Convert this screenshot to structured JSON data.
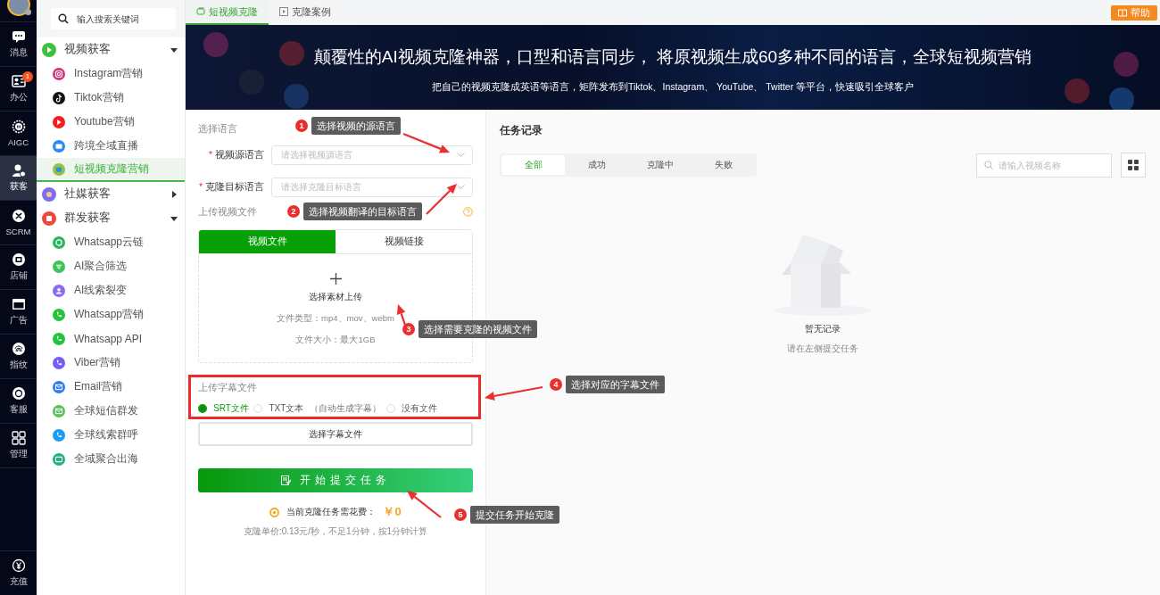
{
  "rail": {
    "items": [
      {
        "label": "消息",
        "selected": false
      },
      {
        "label": "办公",
        "selected": false,
        "badge": "1"
      },
      {
        "label": "AIGC",
        "selected": false
      },
      {
        "label": "获客",
        "selected": true
      },
      {
        "label": "SCRM",
        "selected": false
      },
      {
        "label": "店铺",
        "selected": false
      },
      {
        "label": "广告",
        "selected": false
      },
      {
        "label": "指纹",
        "selected": false
      },
      {
        "label": "客服",
        "selected": false
      },
      {
        "label": "管理",
        "selected": false
      }
    ],
    "bottom": {
      "label": "充值",
      "selected": false
    }
  },
  "sidebar": {
    "search": {
      "placeholder": "输入搜索关键词"
    },
    "groups": [
      {
        "label": "视频获客",
        "expanded": true,
        "children": [
          {
            "label": "Instagram营销",
            "selected": false
          },
          {
            "label": "Tiktok营销",
            "selected": false
          },
          {
            "label": "Youtube营销",
            "selected": false
          },
          {
            "label": "跨境全域直播",
            "selected": false
          },
          {
            "label": "短视频克隆营销",
            "selected": true
          }
        ]
      },
      {
        "label": "社媒获客",
        "expanded": false
      },
      {
        "label": "群发获客",
        "expanded": true,
        "children": [
          {
            "label": "Whatsapp云链",
            "selected": false
          },
          {
            "label": "AI聚合筛选",
            "selected": false
          },
          {
            "label": "AI线索裂变",
            "selected": false
          },
          {
            "label": "Whatsapp营销",
            "selected": false
          },
          {
            "label": "Whatsapp API",
            "selected": false
          },
          {
            "label": "Viber营销",
            "selected": false
          },
          {
            "label": "Email营销",
            "selected": false
          },
          {
            "label": "全球短信群发",
            "selected": false
          },
          {
            "label": "全球线索群呼",
            "selected": false
          },
          {
            "label": "全域聚合出海",
            "selected": false
          }
        ]
      }
    ]
  },
  "tabs": [
    {
      "label": "短视频克隆",
      "selected": true
    },
    {
      "label": "克隆案例",
      "selected": false
    }
  ],
  "help_button": "帮助",
  "banner": {
    "title": "颠覆性的AI视频克隆神器，口型和语言同步， 将原视频生成60多种不同的语言，全球短视频营销",
    "subtitle": "把自己的视频克隆成英语等语言，矩阵发布到Tiktok、Instagram、 YouTube、 Twitter 等平台，快速吸引全球客户"
  },
  "form": {
    "language_section": "选择语言",
    "fields": [
      {
        "required_mark": "*",
        "label": "视频源语言",
        "placeholder": "请选择视频源语言"
      },
      {
        "required_mark": "*",
        "label": "克隆目标语言",
        "placeholder": "请选择克隆目标语言"
      }
    ],
    "upload_section": "上传视频文件",
    "upload_tabs": [
      {
        "label": "视频文件",
        "selected": true
      },
      {
        "label": "视频链接",
        "selected": false
      }
    ],
    "upload_area": {
      "label": "选择素材上传",
      "file_types": "文件类型：mp4、mov、webm",
      "file_size": "文件大小：最大1GB"
    },
    "subtitle_section": "上传字幕文件",
    "subtitle_options": [
      {
        "label": "SRT文件",
        "selected": true
      },
      {
        "label": "TXT文本",
        "note": "（自动生成字幕）",
        "selected": false
      },
      {
        "label": "没有文件",
        "selected": false
      }
    ],
    "subtitle_button": "选择字幕文件",
    "submit_button": "开始提交任务",
    "cost_label": "当前克隆任务需花费：",
    "cost_value": "￥0",
    "pricing_note": "克隆单价:0.13元/秒，不足1分钟，按1分钟计算"
  },
  "tasks": {
    "title": "任务记录",
    "filters": [
      {
        "label": "全部",
        "selected": true
      },
      {
        "label": "成功",
        "selected": false
      },
      {
        "label": "克隆中",
        "selected": false
      },
      {
        "label": "失败",
        "selected": false
      }
    ],
    "search": {
      "placeholder": "请输入视频名称"
    },
    "empty_title": "暂无记录",
    "empty_hint": "请在左侧提交任务"
  },
  "annotations": [
    {
      "number": "1",
      "text": "选择视频的源语言"
    },
    {
      "number": "2",
      "text": "选择视频翻译的目标语言"
    },
    {
      "number": "3",
      "text": "选择需要克隆的视频文件"
    },
    {
      "number": "4",
      "text": "选择对应的字幕文件"
    },
    {
      "number": "5",
      "text": "提交任务开始克隆"
    }
  ]
}
